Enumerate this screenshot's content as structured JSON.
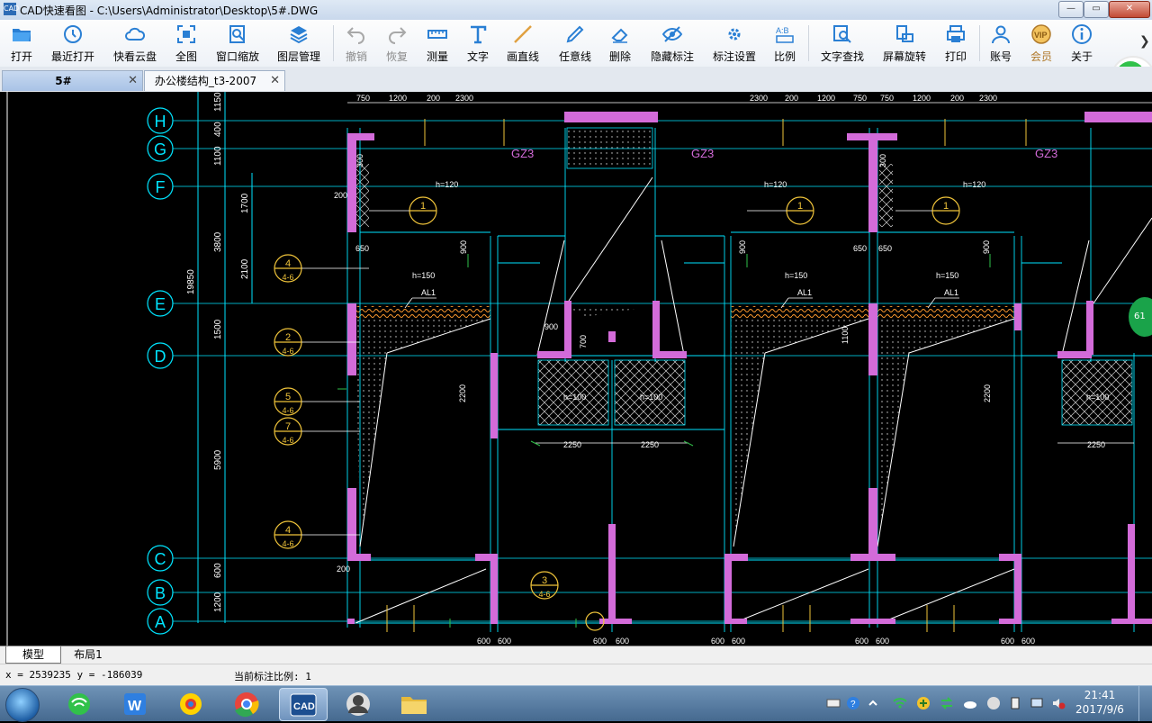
{
  "window": {
    "title": "CAD快速看图 - C:\\Users\\Administrator\\Desktop\\5#.DWG",
    "minimize": "—",
    "maximize": "▭",
    "close": "✕"
  },
  "toolbar": {
    "items": [
      {
        "label": "打开",
        "icon": "folder-open-icon"
      },
      {
        "label": "最近打开",
        "icon": "history-clock-icon"
      },
      {
        "label": "快看云盘",
        "icon": "cloud-icon"
      },
      {
        "label": "全图",
        "icon": "fit-view-icon"
      },
      {
        "label": "窗口缩放",
        "icon": "zoom-window-icon"
      },
      {
        "label": "图层管理",
        "icon": "layers-icon"
      },
      {
        "label": "撤销",
        "icon": "undo-icon"
      },
      {
        "label": "恢复",
        "icon": "redo-icon"
      },
      {
        "label": "测量",
        "icon": "ruler-icon"
      },
      {
        "label": "文字",
        "icon": "text-t-icon"
      },
      {
        "label": "画直线",
        "icon": "line-icon"
      },
      {
        "label": "任意线",
        "icon": "pen-icon"
      },
      {
        "label": "删除",
        "icon": "eraser-icon"
      },
      {
        "label": "隐藏标注",
        "icon": "eye-hide-icon"
      },
      {
        "label": "标注设置",
        "icon": "annotation-settings-icon"
      },
      {
        "label": "比例",
        "icon": "scale-ab-icon"
      },
      {
        "label": "文字查找",
        "icon": "find-text-icon"
      },
      {
        "label": "屏幕旋转",
        "icon": "rotate-screen-icon"
      },
      {
        "label": "打印",
        "icon": "printer-icon"
      },
      {
        "label": "账号",
        "icon": "user-icon"
      },
      {
        "label": "会员",
        "icon": "vip-icon"
      },
      {
        "label": "关于",
        "icon": "info-icon"
      }
    ]
  },
  "tabs": [
    {
      "label": "5#",
      "active": true
    },
    {
      "label": "办公楼结构_t3-2007",
      "active": false
    }
  ],
  "tab_close": "✕",
  "drawing": {
    "axis_labels": [
      "H",
      "G",
      "F",
      "E",
      "D",
      "C",
      "B",
      "A"
    ],
    "vertical_dims": [
      "1150",
      "400",
      "1100",
      "3800",
      "1700",
      "2100",
      "19850",
      "1500",
      "5900",
      "600",
      "1200"
    ],
    "gz_labels": [
      "GZ3",
      "GZ3",
      "GZ3"
    ],
    "h_labels": [
      "h=120",
      "h=120",
      "h=120",
      "h=150",
      "h=150",
      "h=150",
      "h=100",
      "h=100",
      "h=100"
    ],
    "al_labels": [
      "AL1",
      "AL1",
      "AL1"
    ],
    "top_dims": [
      "750",
      "1200",
      "200",
      "2300",
      "2300",
      "200",
      "1200",
      "750",
      "750",
      "1200",
      "200",
      "2300"
    ],
    "bottom_dims": [
      "2250",
      "2250",
      "2250"
    ],
    "detail_marks": [
      "1",
      "1",
      "1",
      "4",
      "2",
      "5",
      "7",
      "4",
      "3"
    ],
    "detail_sub": [
      "4-6"
    ],
    "misc_dims": [
      "650",
      "650",
      "650",
      "900",
      "900",
      "900",
      "900",
      "2200",
      "2200",
      "600",
      "600",
      "600",
      "600",
      "600",
      "600",
      "600",
      "600",
      "600",
      "600",
      "200",
      "200",
      "300",
      "300",
      "1100",
      "700"
    ]
  },
  "side_badge": "61",
  "layout_tabs": [
    {
      "label": "模型",
      "active": true
    },
    {
      "label": "布局1",
      "active": false
    }
  ],
  "status": {
    "coords": "x = 2539235  y = -186039",
    "scale": "当前标注比例: 1"
  },
  "taskbar": {
    "time": "21:41",
    "date": "2017/9/6",
    "apps": [
      "ie-icon",
      "wps-icon",
      "browser-icon",
      "chrome-icon",
      "cad-icon",
      "avatar-app-icon",
      "file-explorer-icon"
    ]
  },
  "colors": {
    "canvas_bg": "#000000",
    "axis_line": "#00e5ff",
    "wall": "#d36bd9",
    "dimension": "#e8e8e8",
    "detail_circle": "#f0c43a",
    "hatch": "#ff9a2e",
    "green": "#31c14a"
  }
}
